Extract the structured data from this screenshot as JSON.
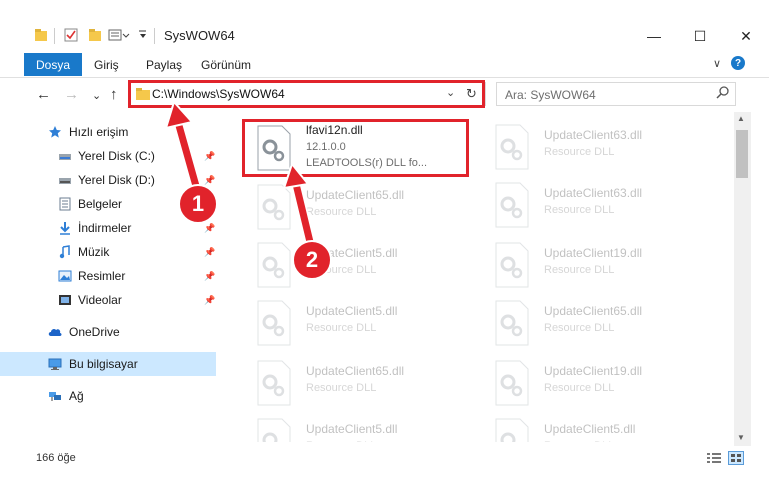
{
  "window": {
    "title": "SysWOW64",
    "minimize": "—",
    "maximize": "☐",
    "close": "✕"
  },
  "ribbon": {
    "tabs": [
      "Dosya",
      "Giriş",
      "Paylaş",
      "Görünüm"
    ],
    "expand": "∨",
    "help": "?"
  },
  "address": {
    "path": "C:\\Windows\\SysWOW64",
    "chevron": "⌄",
    "refresh": "↻"
  },
  "search": {
    "placeholder": "Ara: SysWOW64"
  },
  "nav": {
    "back": "←",
    "forward": "→",
    "recent": "⌄",
    "up": "↑"
  },
  "sidebar": {
    "items": [
      {
        "label": "Hızlı erişim",
        "icon": "star-icon"
      },
      {
        "label": "Yerel Disk (C:)",
        "icon": "drive-icon",
        "pinned": true
      },
      {
        "label": "Yerel Disk (D:)",
        "icon": "drive-icon",
        "pinned": true
      },
      {
        "label": "Belgeler",
        "icon": "document-icon",
        "pinned": true
      },
      {
        "label": "İndirmeler",
        "icon": "download-icon",
        "pinned": true
      },
      {
        "label": "Müzik",
        "icon": "music-icon",
        "pinned": true
      },
      {
        "label": "Resimler",
        "icon": "pictures-icon",
        "pinned": true
      },
      {
        "label": "Videolar",
        "icon": "video-icon",
        "pinned": true
      },
      {
        "label": "OneDrive",
        "icon": "cloud-icon"
      },
      {
        "label": "Bu bilgisayar",
        "icon": "computer-icon"
      },
      {
        "label": "Ağ",
        "icon": "network-icon"
      }
    ]
  },
  "files": {
    "highlighted": {
      "name": "lfavi12n.dll",
      "version": "12.1.0.0",
      "description": "LEADTOOLS(r) DLL fo..."
    },
    "col1": [
      {
        "name": "UpdateClient65.dll",
        "type": "Resource DLL"
      },
      {
        "name": "UpdateClient5.dll",
        "type": "Resource DLL"
      },
      {
        "name": "UpdateClient5.dll",
        "type": "Resource DLL"
      },
      {
        "name": "UpdateClient65.dll",
        "type": "Resource DLL"
      },
      {
        "name": "UpdateClient5.dll",
        "type": "Resource DLL"
      }
    ],
    "col2": [
      {
        "name": "UpdateClient63.dll",
        "type": "Resource DLL"
      },
      {
        "name": "UpdateClient63.dll",
        "type": "Resource DLL"
      },
      {
        "name": "UpdateClient19.dll",
        "type": "Resource DLL"
      },
      {
        "name": "UpdateClient65.dll",
        "type": "Resource DLL"
      },
      {
        "name": "UpdateClient19.dll",
        "type": "Resource DLL"
      },
      {
        "name": "UpdateClient5.dll",
        "type": "Resource DLL"
      }
    ]
  },
  "status": {
    "count": "166 öğe"
  },
  "annotations": {
    "step1": "1",
    "step2": "2",
    "color": "#e1232b"
  },
  "colors": {
    "accent": "#1979ca",
    "selected": "#cce8ff"
  }
}
